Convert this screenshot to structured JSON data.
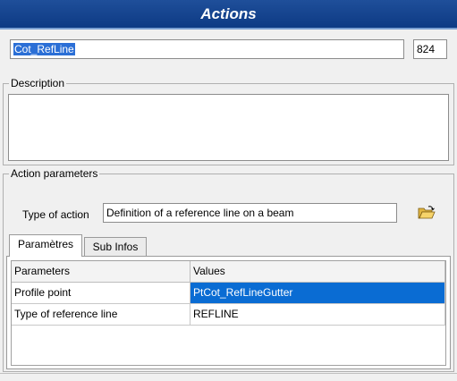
{
  "window": {
    "title": "Actions"
  },
  "header": {
    "name_value": "Cot_RefLine",
    "id_value": "824"
  },
  "description": {
    "legend": "Description",
    "value": ""
  },
  "action_parameters": {
    "legend": "Action parameters",
    "type_label": "Type of action",
    "type_value": "Definition of a reference line on a beam",
    "browse_icon": "folder-open-icon"
  },
  "tabs": [
    {
      "label": "Paramètres"
    },
    {
      "label": "Sub Infos"
    }
  ],
  "grid": {
    "columns": [
      "Parameters",
      "Values"
    ],
    "rows": [
      {
        "name": "Profile point",
        "value": "PtCot_RefLineGutter"
      },
      {
        "name": "Type of reference line",
        "value": "REFLINE"
      }
    ]
  },
  "colors": {
    "titlebar": "#1f4f9a",
    "selection": "#0a6cd3"
  }
}
